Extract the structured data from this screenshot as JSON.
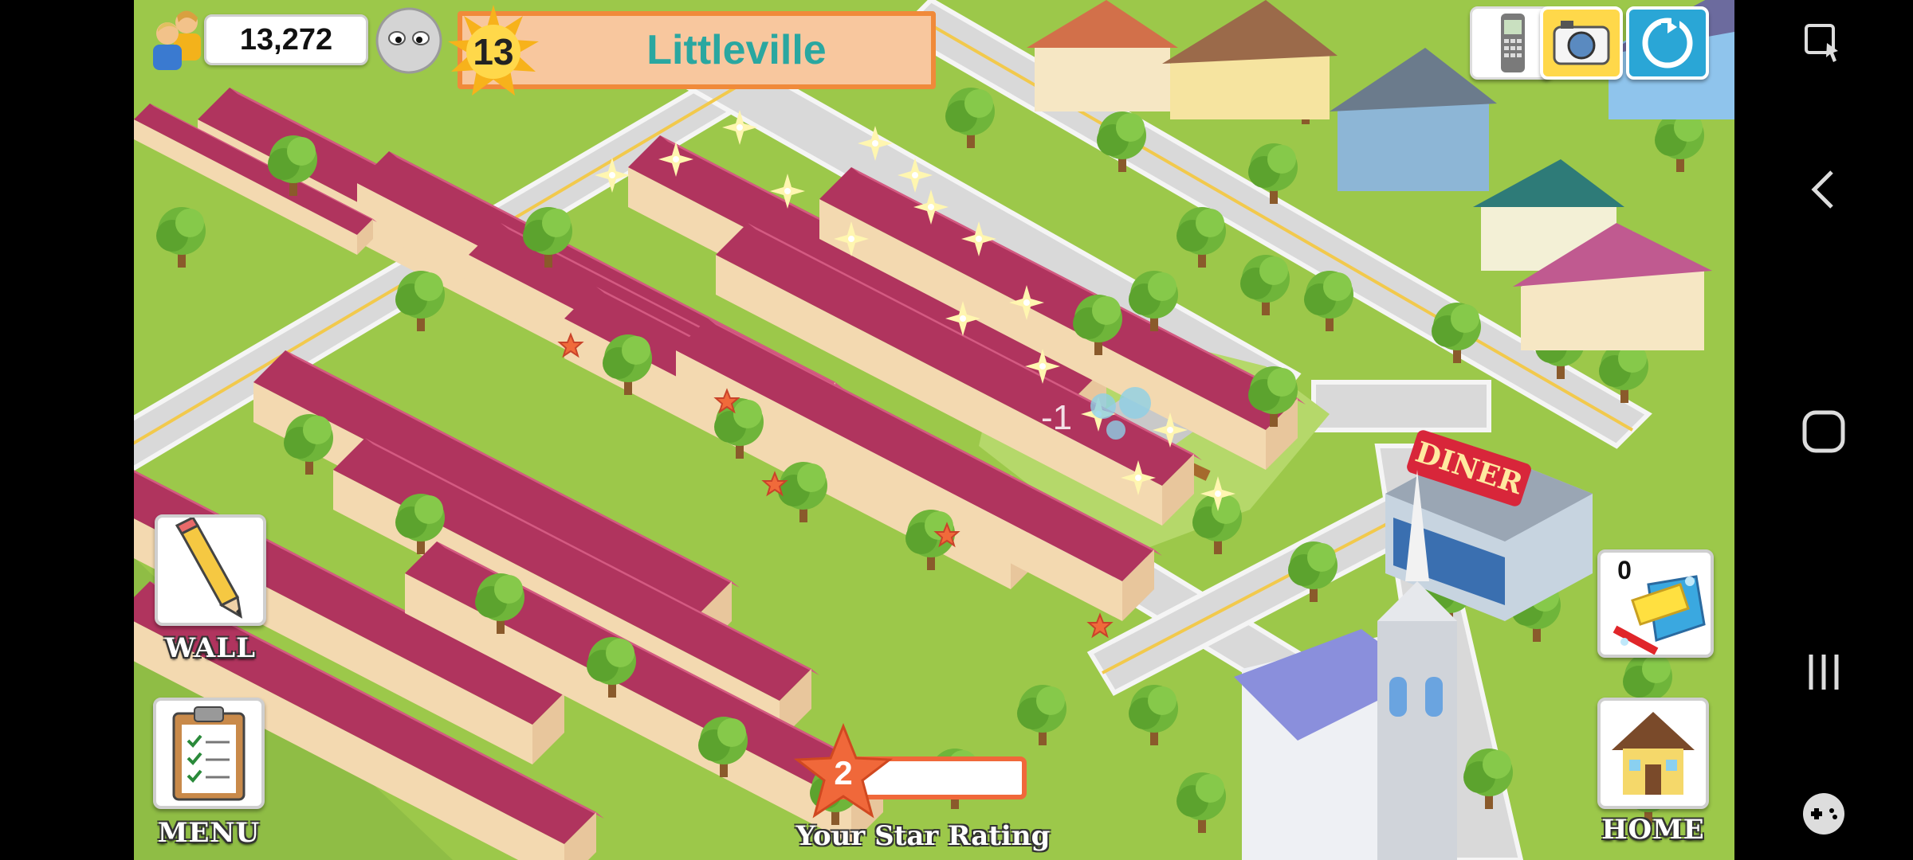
{
  "hud": {
    "population": "13,272",
    "level": "13",
    "town_name": "Littleville"
  },
  "side_buttons": {
    "wall_label": "WALL",
    "menu_label": "MENU",
    "home_label": "HOME",
    "clean_count": "0"
  },
  "star_rating": {
    "value": "2",
    "label": "Your Star Rating",
    "progress": 0.0
  },
  "floating_text": "-1",
  "buildings": {
    "diner_sign": "DINER"
  },
  "icons": {
    "population": "people-icon",
    "alien": "alien-face-icon",
    "level": "sun-badge-icon",
    "phone": "phone-icon",
    "camera": "camera-icon",
    "share": "share-icon",
    "wall": "pencil-icon",
    "menu": "clipboard-icon",
    "home": "house-icon",
    "clean": "sponge-bucket-icon"
  },
  "system_nav": {
    "items": [
      "screenshot-icon",
      "back-icon",
      "home-circle-icon",
      "recents-icon",
      "game-tools-icon"
    ]
  },
  "colors": {
    "grass": "#9cc84a",
    "road": "#c8c8c8",
    "roof": "#b0345e",
    "banner": "#f8c79e",
    "banner_border": "#f08a3a",
    "town_text": "#2aa7a0",
    "rating_border": "#f0683a"
  }
}
